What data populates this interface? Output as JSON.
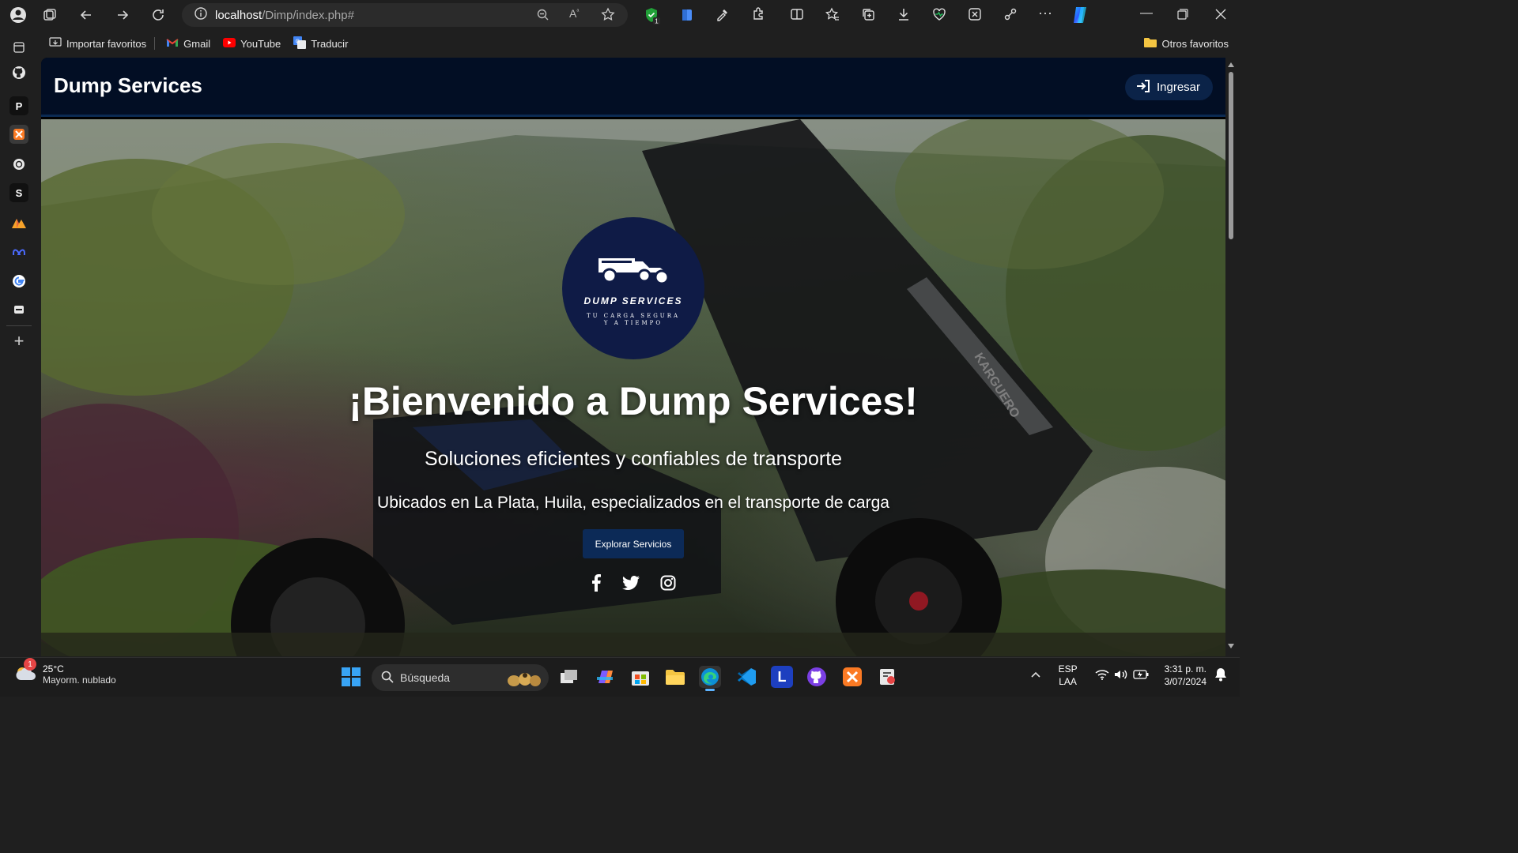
{
  "browser": {
    "url_host": "localhost",
    "url_path": "/Dimp/index.php#",
    "favorites": [
      {
        "label": "Importar favoritos",
        "icon": "import-icon"
      },
      {
        "label": "Gmail",
        "icon": "gmail-icon"
      },
      {
        "label": "YouTube",
        "icon": "youtube-icon"
      },
      {
        "label": "Traducir",
        "icon": "translate-icon"
      }
    ],
    "other_favorites": "Otros favoritos",
    "sidebar_letters": {
      "p": "P",
      "s": "S"
    }
  },
  "page": {
    "brand": "Dump Services",
    "login_label": "Ingresar",
    "logo_name": "DUMP SERVICES",
    "logo_tagline": "TU CARGA SEGURA Y A TIEMPO",
    "hero_title": "¡Bienvenido a Dump Services!",
    "hero_subtitle": "Soluciones eficientes y confiables de transporte",
    "hero_location": "Ubicados en La Plata, Huila, especializados en el transporte de carga",
    "explore_label": "Explorar Servicios",
    "social": [
      "facebook-icon",
      "twitter-icon",
      "instagram-icon"
    ]
  },
  "taskbar": {
    "weather_temp": "25°C",
    "weather_condition": "Mayorm. nublado",
    "weather_badge": "1",
    "search_placeholder": "Búsqueda",
    "lang_top": "ESP",
    "lang_bottom": "LAA",
    "time": "3:31 p. m.",
    "date": "3/07/2024"
  },
  "colors": {
    "navbar": "#020e24",
    "button": "#0c2a57",
    "logo_bg": "#0f1b46"
  }
}
